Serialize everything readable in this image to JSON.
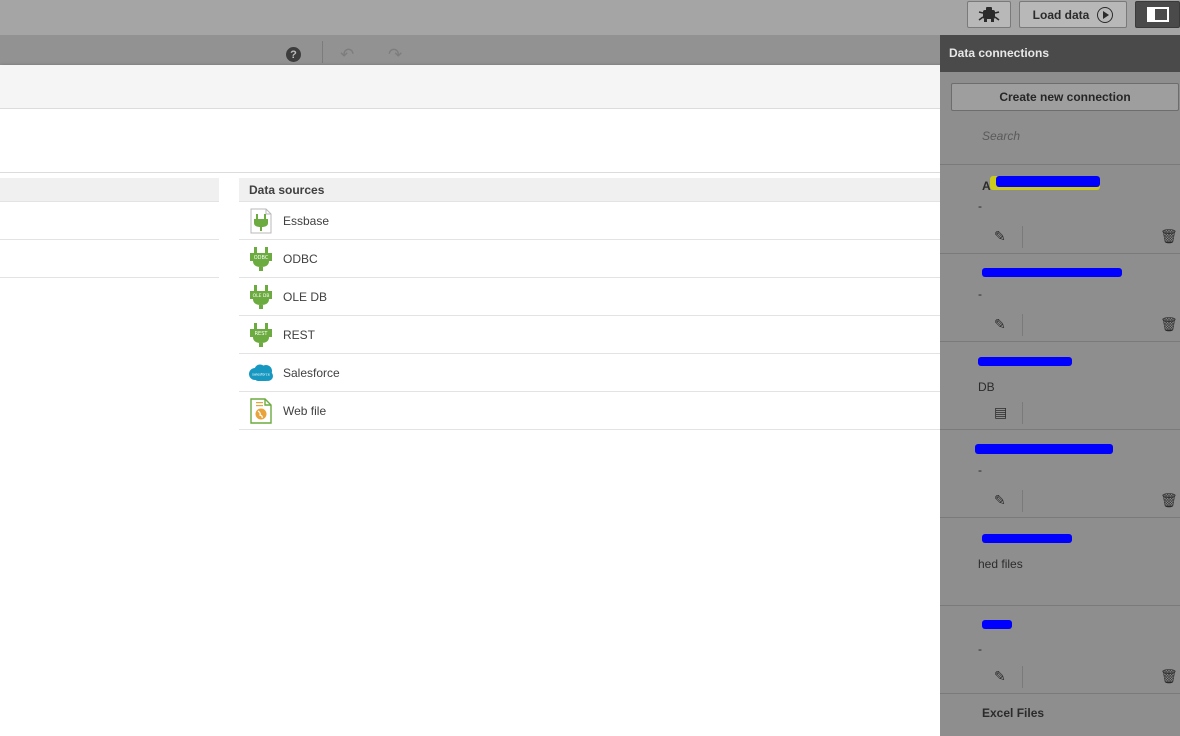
{
  "topbar": {
    "debug_icon": "bug-icon",
    "load_label": "Load data",
    "panel_icon": "panel-toggle-icon"
  },
  "toolbar": {
    "help_glyph": "?",
    "undo_glyph": "↶",
    "redo_glyph": "↷"
  },
  "data_sources": {
    "header": "Data sources",
    "items": [
      {
        "label": "Essbase",
        "icon": "essbase-plug-icon"
      },
      {
        "label": "ODBC",
        "icon": "odbc-plug-icon",
        "badge": "ODBC"
      },
      {
        "label": "OLE DB",
        "icon": "oledb-plug-icon",
        "badge": "OLE DB"
      },
      {
        "label": "REST",
        "icon": "rest-plug-icon",
        "badge": "REST"
      },
      {
        "label": "Salesforce",
        "icon": "salesforce-cloud-icon",
        "badge": "salesforce"
      },
      {
        "label": "Web file",
        "icon": "web-file-icon"
      }
    ]
  },
  "connections": {
    "header": "Data connections",
    "create_label": "Create new connection",
    "search_placeholder": "Search",
    "items": [
      {
        "name": "A",
        "sub": "-"
      },
      {
        "name": "",
        "sub": "-"
      },
      {
        "name": "",
        "sub": "DB"
      },
      {
        "name": "",
        "sub": "-"
      },
      {
        "name": "",
        "sub": "hed files"
      },
      {
        "name": "",
        "sub": "-"
      },
      {
        "name": "Excel Files",
        "sub": ""
      }
    ]
  },
  "colors": {
    "accent_green": "#6bab3f",
    "salesforce_blue": "#1798c1",
    "redaction_blue": "#0000ff"
  }
}
